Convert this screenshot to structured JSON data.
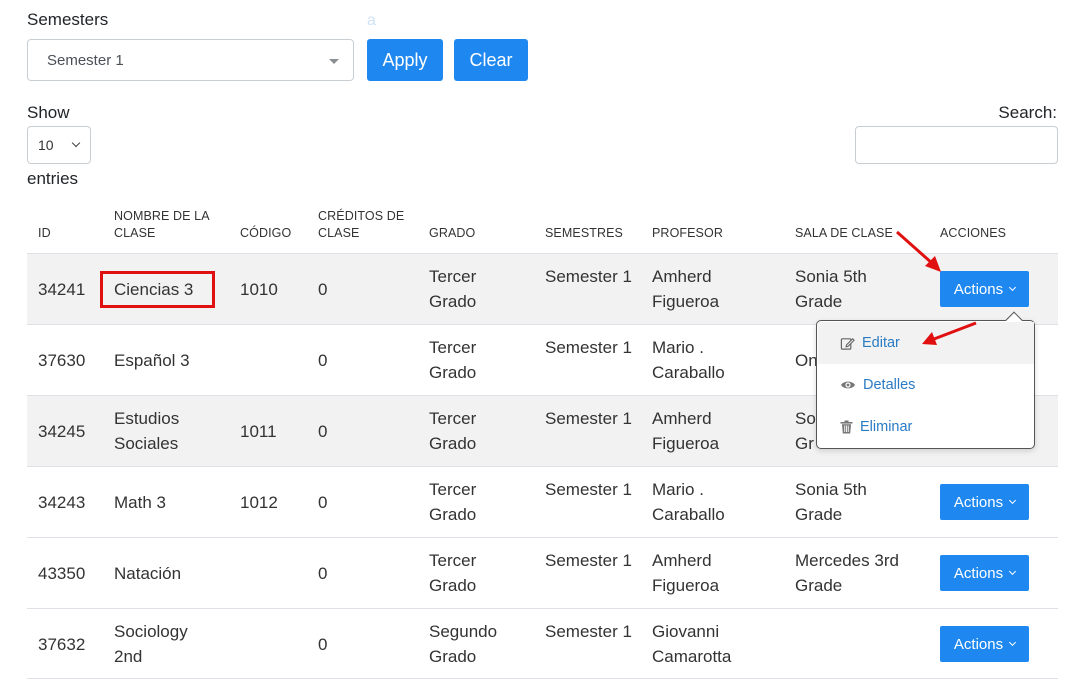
{
  "filter": {
    "label": "Semesters",
    "stray_text": "a",
    "semester_selected": "Semester 1",
    "apply_label": "Apply",
    "clear_label": "Clear"
  },
  "length_menu": {
    "show_label": "Show",
    "value": "10",
    "entries_label": "entries"
  },
  "search": {
    "label": "Search:",
    "value": ""
  },
  "table": {
    "headers": {
      "id": "ID",
      "name": "NOMBRE DE LA CLASE",
      "code": "CÓDIGO",
      "credits": "CRÉDITOS DE CLASE",
      "grade": "GRADO",
      "semesters": "SEMESTRES",
      "teacher": "PROFESOR",
      "room": "SALA DE CLASE",
      "actions": "ACCIONES"
    },
    "rows": [
      {
        "id": "34241",
        "name": "Ciencias 3",
        "code": "1010",
        "credits": "0",
        "grade": "Tercer Grado",
        "semester": "Semester 1",
        "teacher": "Amherd Figueroa",
        "room": "Sonia 5th Grade",
        "action": "Actions"
      },
      {
        "id": "37630",
        "name": "Español 3",
        "code": "",
        "credits": "0",
        "grade": "Tercer Grado",
        "semester": "Semester 1",
        "teacher": "Mario . Caraballo",
        "room": "On",
        "action": ""
      },
      {
        "id": "34245",
        "name": "Estudios Sociales",
        "code": "1011",
        "credits": "0",
        "grade": "Tercer Grado",
        "semester": "Semester 1",
        "teacher": "Amherd Figueroa",
        "room": "So Gr",
        "action": ""
      },
      {
        "id": "34243",
        "name": "Math 3",
        "code": "1012",
        "credits": "0",
        "grade": "Tercer Grado",
        "semester": "Semester 1",
        "teacher": "Mario . Caraballo",
        "room": "Sonia 5th Grade",
        "action": "Actions"
      },
      {
        "id": "43350",
        "name": "Natación",
        "code": "",
        "credits": "0",
        "grade": "Tercer Grado",
        "semester": "Semester 1",
        "teacher": "Amherd Figueroa",
        "room": "Mercedes 3rd Grade",
        "action": "Actions"
      },
      {
        "id": "37632",
        "name": "Sociology 2nd",
        "code": "",
        "credits": "0",
        "grade": "Segundo Grado",
        "semester": "Semester 1",
        "teacher": "Giovanni Camarotta",
        "room": "",
        "action": "Actions"
      }
    ]
  },
  "dropdown": {
    "items": [
      {
        "label": "Editar",
        "icon": "edit-icon"
      },
      {
        "label": "Detalles",
        "icon": "eye-icon"
      },
      {
        "label": "Eliminar",
        "icon": "trash-icon"
      }
    ]
  },
  "colors": {
    "primary": "#1e88f0",
    "annotation_red": "#e01010",
    "link": "#2a7bc4",
    "stripe": "#f2f2f2"
  }
}
